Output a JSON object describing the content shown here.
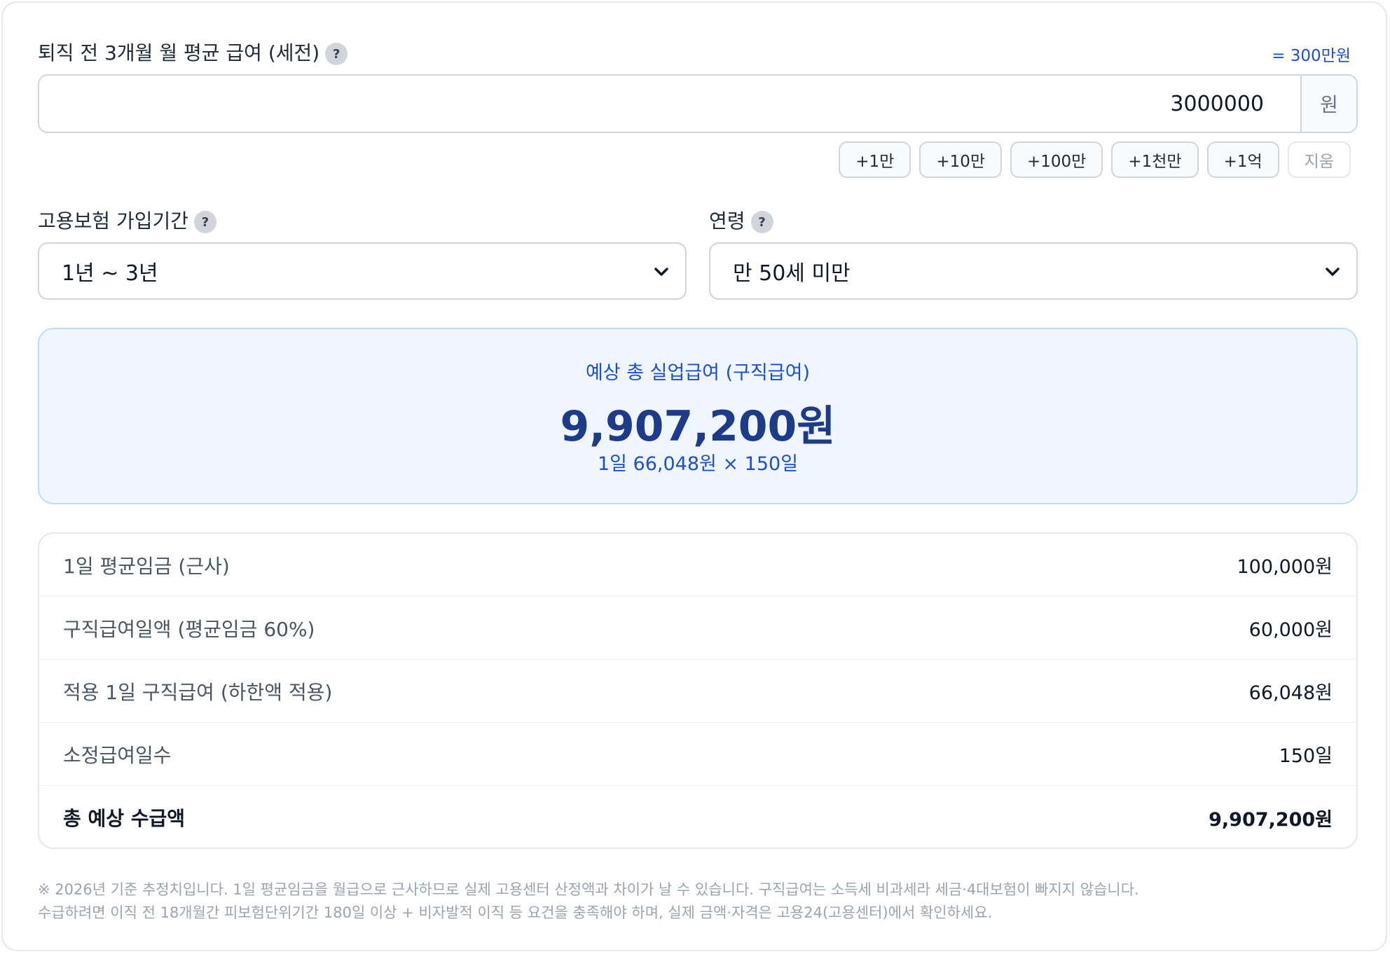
{
  "salary": {
    "label": "퇴직 전 3개월 월 평균 급여 (세전)",
    "hint": "= 300만원",
    "value": "3000000",
    "unit": "원",
    "quick_buttons": [
      "+1만",
      "+10만",
      "+100만",
      "+1천만",
      "+1억"
    ],
    "clear_label": "지움"
  },
  "insurance_period": {
    "label": "고용보험 가입기간",
    "selected": "1년 ~ 3년"
  },
  "age": {
    "label": "연령",
    "selected": "만 50세 미만"
  },
  "help_symbol": "?",
  "result": {
    "label": "예상 총 실업급여 (구직급여)",
    "total": "9,907,200원",
    "formula": "1일 66,048원 × 150일"
  },
  "breakdown": [
    {
      "label": "1일 평균임금 (근사)",
      "value": "100,000원"
    },
    {
      "label": "구직급여일액 (평균임금 60%)",
      "value": "60,000원"
    },
    {
      "label": "적용 1일 구직급여 (하한액 적용)",
      "value": "66,048원"
    },
    {
      "label": "소정급여일수",
      "value": "150일"
    },
    {
      "label": "총 예상 수급액",
      "value": "9,907,200원"
    }
  ],
  "notes": [
    "※ 2026년 기준 추정치입니다. 1일 평균임금을 월급으로 근사하므로 실제 고용센터 산정액과 차이가 날 수 있습니다. 구직급여는 소득세 비과세라 세금·4대보험이 빠지지 않습니다.",
    "수급하려면 이직 전 18개월간 피보험단위기간 180일 이상 + 비자발적 이직 등 요건을 충족해야 하며, 실제 금액·자격은 고용24(고용센터)에서 확인하세요."
  ],
  "colors": {
    "accent": "#1d4ed8",
    "result_bg": "#eff6ff",
    "total_text": "#1e3a8a"
  }
}
